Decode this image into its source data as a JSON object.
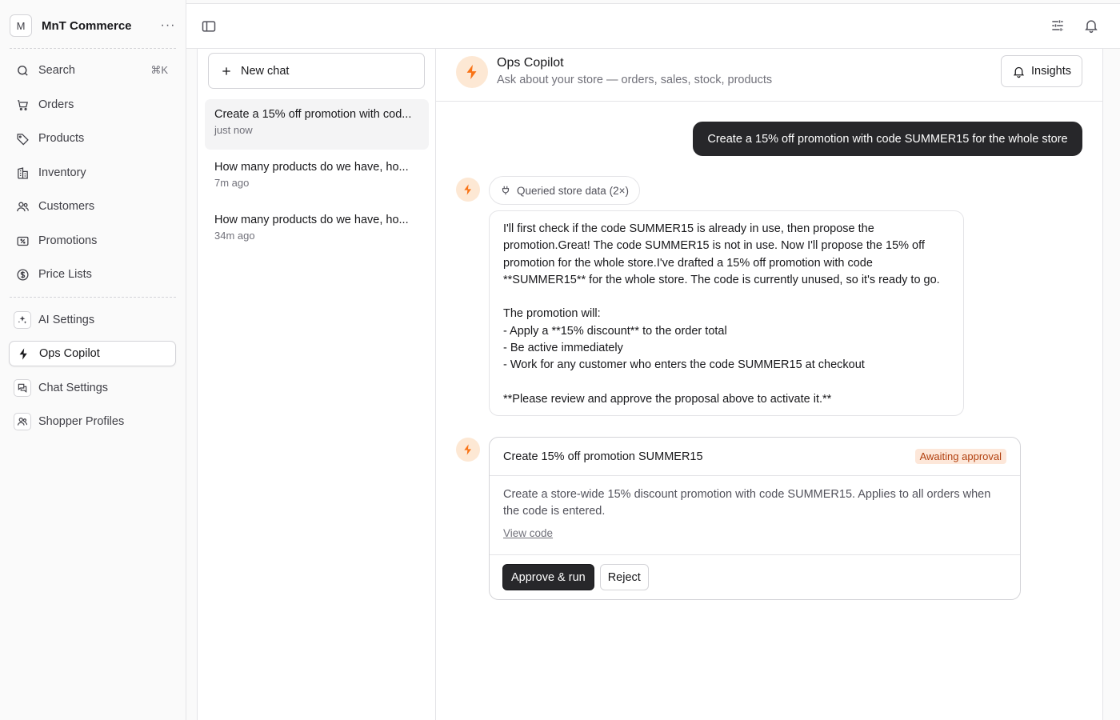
{
  "sidebar": {
    "store": {
      "initial": "M",
      "name": "MnT Commerce",
      "more": "···"
    },
    "search": {
      "label": "Search",
      "shortcut": "⌘K"
    },
    "items": [
      {
        "label": "Orders",
        "icon": "cart-icon"
      },
      {
        "label": "Products",
        "icon": "tag-icon"
      },
      {
        "label": "Inventory",
        "icon": "building-icon"
      },
      {
        "label": "Customers",
        "icon": "users-icon"
      },
      {
        "label": "Promotions",
        "icon": "ticket-icon"
      },
      {
        "label": "Price Lists",
        "icon": "dollar-circle-icon"
      }
    ],
    "extensions": [
      {
        "label": "AI Settings",
        "icon": "sparkles-icon"
      },
      {
        "label": "Ops Copilot",
        "icon": "bolt-icon",
        "active": true
      },
      {
        "label": "Chat Settings",
        "icon": "chat-bubbles-icon"
      },
      {
        "label": "Shopper Profiles",
        "icon": "users-icon"
      }
    ]
  },
  "chat_list": {
    "new_chat_label": "New chat",
    "chats": [
      {
        "title": "Create a 15% off promotion with cod...",
        "time": "just now",
        "active": true
      },
      {
        "title": "How many products do we have, ho...",
        "time": "7m ago"
      },
      {
        "title": "How many products do we have, ho...",
        "time": "34m ago"
      }
    ]
  },
  "main": {
    "title": "Ops Copilot",
    "subtitle": "Ask about your store — orders, sales, stock, products",
    "insights_label": "Insights",
    "user_message": "Create a 15% off promotion with code SUMMER15 for the whole store",
    "tool_call": "Queried store data (2×)",
    "assistant_message": "I'll first check if the code SUMMER15 is already in use, then propose the promotion.Great! The code SUMMER15 is not in use. Now I'll propose the 15% off promotion for the whole store.I've drafted a 15% off promotion with code **SUMMER15** for the whole store. The code is currently unused, so it's ready to go.\n\nThe promotion will:\n- Apply a **15% discount** to the order total\n- Be active immediately\n- Work for any customer who enters the code SUMMER15 at checkout\n\n**Please review and approve the proposal above to activate it.**",
    "proposal": {
      "title": "Create 15% off promotion SUMMER15",
      "status": "Awaiting approval",
      "description": "Create a store-wide 15% discount promotion with code SUMMER15. Applies to all orders when the code is entered.",
      "view_code_label": "View code",
      "approve_label": "Approve & run",
      "reject_label": "Reject"
    }
  },
  "colors": {
    "accent": "#f97316",
    "accent_bg": "#fde8d4",
    "dark": "#27272a"
  }
}
